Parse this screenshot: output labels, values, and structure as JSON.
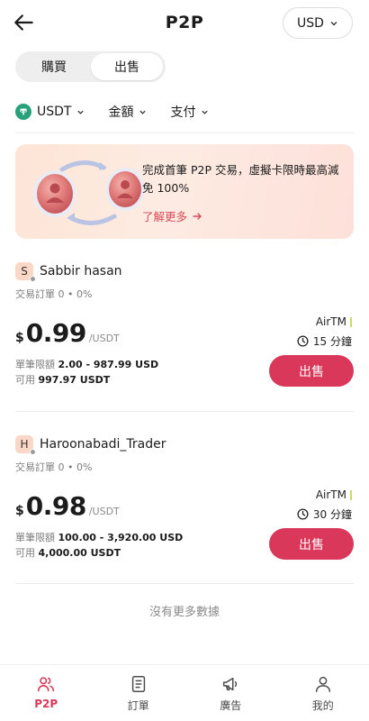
{
  "header": {
    "title": "P2P",
    "currency": "USD"
  },
  "segment": {
    "buy_label": "購買",
    "sell_label": "出售",
    "selected": "出售"
  },
  "filters": {
    "asset": "USDT",
    "amount": "金額",
    "payment": "支付"
  },
  "banner": {
    "text": "完成首筆 P2P 交易，虛擬卡限時最高減免 100%",
    "link": "了解更多"
  },
  "listings": [
    {
      "initial": "S",
      "name": "Sabbir hasan",
      "stats": "交易訂單 0 • 0%",
      "currency_symbol": "$",
      "price": "0.99",
      "unit": "/USDT",
      "limit_label": "單筆限額",
      "limit_value": "2.00 - 987.99 USD",
      "available_label": "可用",
      "available_value": "997.97 USDT",
      "payment_method": "AirTM",
      "time": "15 分鐘",
      "action": "出售"
    },
    {
      "initial": "H",
      "name": "Haroonabadi_Trader",
      "stats": "交易訂單 0 • 0%",
      "currency_symbol": "$",
      "price": "0.98",
      "unit": "/USDT",
      "limit_label": "單筆限額",
      "limit_value": "100.00 - 3,920.00 USD",
      "available_label": "可用",
      "available_value": "4,000.00 USDT",
      "payment_method": "AirTM",
      "time": "30 分鐘",
      "action": "出售"
    }
  ],
  "footer_note": "沒有更多數據",
  "tabs": [
    {
      "label": "P2P",
      "icon": "users-icon",
      "active": true
    },
    {
      "label": "訂單",
      "icon": "orders-icon",
      "active": false
    },
    {
      "label": "廣告",
      "icon": "megaphone-icon",
      "active": false
    },
    {
      "label": "我的",
      "icon": "profile-icon",
      "active": false
    }
  ],
  "colors": {
    "accent": "#d9385a",
    "usdt": "#26a17b",
    "banner_bg": "#fde5d6"
  }
}
